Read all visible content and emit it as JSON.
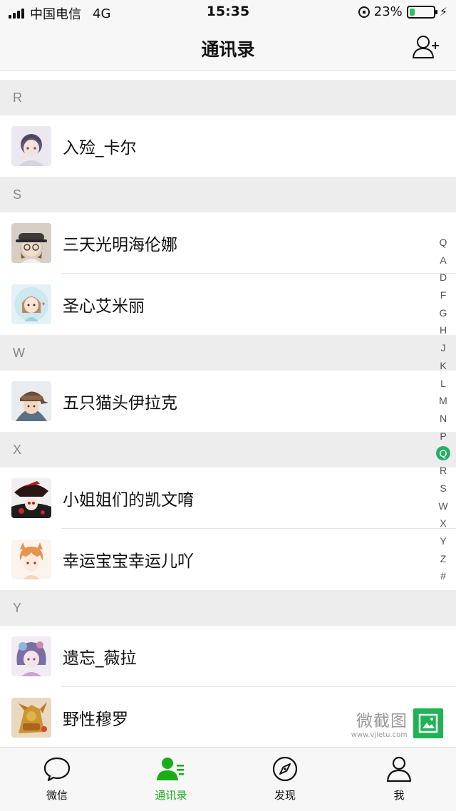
{
  "status_bar": {
    "carrier": "中国电信",
    "network": "4G",
    "time": "15:35",
    "battery_percent": "23%",
    "battery_level": 0.23
  },
  "nav": {
    "title": "通讯录",
    "add_icon": "add-contact-icon"
  },
  "sections": [
    {
      "letter": "R",
      "contacts": [
        {
          "name": "入殓_卡尔",
          "avatar": "avatar-anime-girl-purple"
        }
      ]
    },
    {
      "letter": "S",
      "contacts": [
        {
          "name": "三天光明海伦娜",
          "avatar": "avatar-hat-glasses"
        },
        {
          "name": "圣心艾米丽",
          "avatar": "avatar-cartoon-girl"
        }
      ]
    },
    {
      "letter": "W",
      "contacts": [
        {
          "name": "五只猫头伊拉克",
          "avatar": "avatar-cap-boy"
        }
      ]
    },
    {
      "letter": "X",
      "contacts": [
        {
          "name": "小姐姐们的凯文唷",
          "avatar": "avatar-red-hat"
        },
        {
          "name": "幸运宝宝幸运儿吖",
          "avatar": "avatar-orange-hair"
        }
      ]
    },
    {
      "letter": "Y",
      "contacts": [
        {
          "name": "遗忘_薇拉",
          "avatar": "avatar-pastel-girl"
        },
        {
          "name": "野性穆罗",
          "avatar": "avatar-golden-figure"
        }
      ]
    }
  ],
  "index_letters": [
    "Q",
    "A",
    "D",
    "F",
    "G",
    "H",
    "J",
    "K",
    "L",
    "M",
    "N",
    "P",
    "Q",
    "R",
    "S",
    "W",
    "X",
    "Y",
    "Z",
    "#"
  ],
  "index_active_position": 12,
  "watermark": {
    "title": "微截图",
    "url": "www.vjietu.com"
  },
  "tabs": [
    {
      "label": "微信",
      "icon": "chat-bubble-icon"
    },
    {
      "label": "通讯录",
      "icon": "contacts-icon",
      "active": true
    },
    {
      "label": "发现",
      "icon": "compass-icon"
    },
    {
      "label": "我",
      "icon": "person-icon"
    }
  ],
  "colors": {
    "accent": "#1aad19",
    "index_active": "#2aae67",
    "battery": "#2cc25b",
    "section_bg": "#ededed"
  }
}
